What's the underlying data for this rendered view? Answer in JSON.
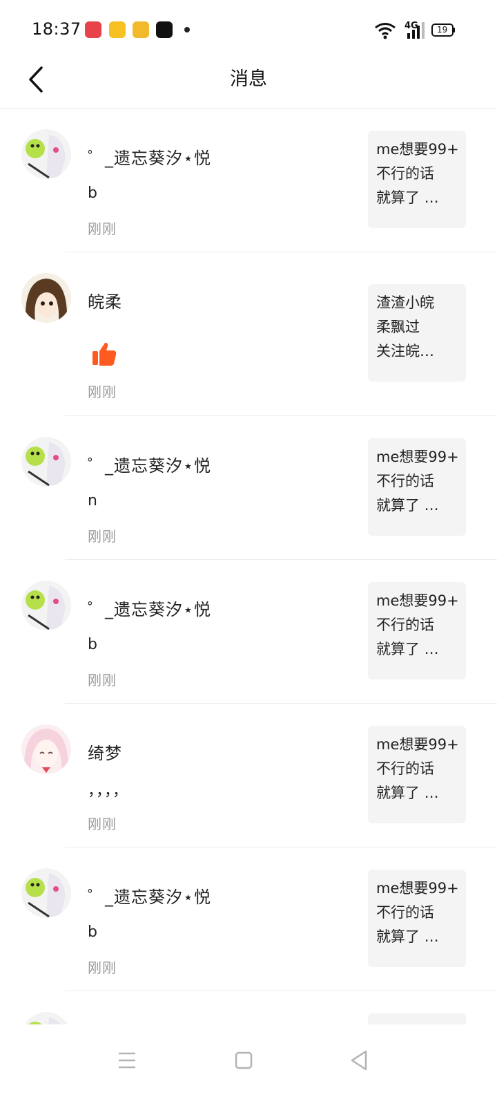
{
  "status_bar": {
    "time": "18:37",
    "network": "4G",
    "battery": "19",
    "app_icon_colors": [
      "#e8434a",
      "#f7c023",
      "#f2b92c",
      "#111111"
    ]
  },
  "header": {
    "title": "消息"
  },
  "messages": [
    {
      "name": "゜_遗忘葵汐⋆悦",
      "text": "b",
      "time": "刚刚",
      "preview": [
        "me想要99+",
        "不行的话",
        "就算了 …"
      ],
      "avatar": "anime-girl-green-mascot"
    },
    {
      "name": "皖柔",
      "text": "",
      "icon": "thumbs-up-icon",
      "time": "刚刚",
      "preview": [
        "渣渣小皖",
        "柔飘过",
        "关注皖…"
      ],
      "avatar": "anime-girl-brown-hair"
    },
    {
      "name": "゜_遗忘葵汐⋆悦",
      "text": "n",
      "time": "刚刚",
      "preview": [
        "me想要99+",
        "不行的话",
        "就算了 …"
      ],
      "avatar": "anime-girl-green-mascot"
    },
    {
      "name": "゜_遗忘葵汐⋆悦",
      "text": "b",
      "time": "刚刚",
      "preview": [
        "me想要99+",
        "不行的话",
        "就算了 …"
      ],
      "avatar": "anime-girl-green-mascot"
    },
    {
      "name": "绮梦",
      "text": "，，，，",
      "time": "刚刚",
      "preview": [
        "me想要99+",
        "不行的话",
        "就算了 …"
      ],
      "avatar": "anime-girl-pink-hair"
    },
    {
      "name": "゜_遗忘葵汐⋆悦",
      "text": "b",
      "time": "刚刚",
      "preview": [
        "me想要99+",
        "不行的话",
        "就算了 …"
      ],
      "avatar": "anime-girl-green-mascot"
    }
  ],
  "colors": {
    "accent_like": "#ff5a1f",
    "preview_bg": "#f4f4f4",
    "muted_text": "#9a9a9a"
  }
}
